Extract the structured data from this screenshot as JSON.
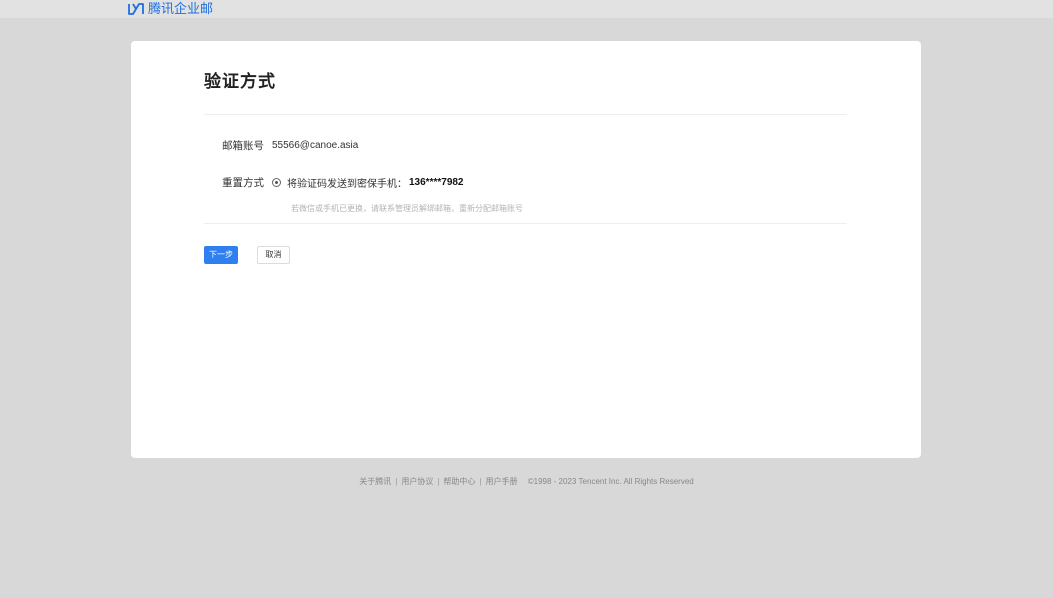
{
  "header": {
    "brand_name": "腾讯企业邮",
    "brand_color": "#1e6fe0"
  },
  "card": {
    "title": "验证方式",
    "account_label": "邮箱账号",
    "account_value": "55566@canoe.asia",
    "method_label": "重置方式",
    "method_option": "将验证码发送到密保手机：",
    "phone_masked": "136****7982",
    "hint": "若微信或手机已更换，请联系管理员解绑邮箱，重新分配邮箱账号",
    "next_button": "下一步",
    "cancel_button": "取消",
    "accent_color": "#2f7ff1"
  },
  "footer": {
    "links": [
      "关于腾讯",
      "用户协议",
      "帮助中心",
      "用户手册"
    ],
    "copyright": "©1998 - 2023 Tencent Inc. All Rights Reserved"
  }
}
